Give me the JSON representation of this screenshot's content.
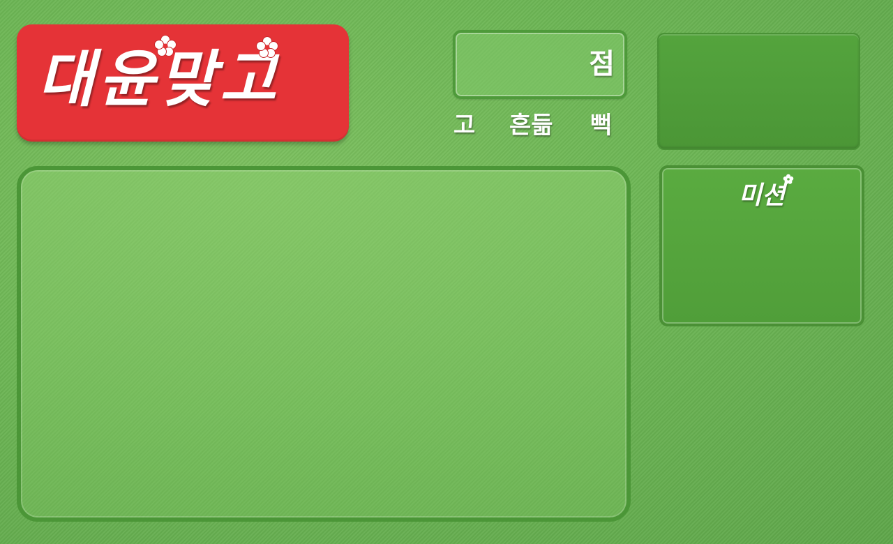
{
  "title": {
    "text": "대윤맞고",
    "flower_icon": "flower-icon"
  },
  "score": {
    "unit": "점"
  },
  "status": {
    "go": "고",
    "shake": "흔듦",
    "bbeok": "뻑"
  },
  "mission": {
    "title": "미션"
  },
  "colors": {
    "background": "#6ab352",
    "logo_bg": "#e53337",
    "panel_border": "#4b9637",
    "text": "#ffffff"
  }
}
